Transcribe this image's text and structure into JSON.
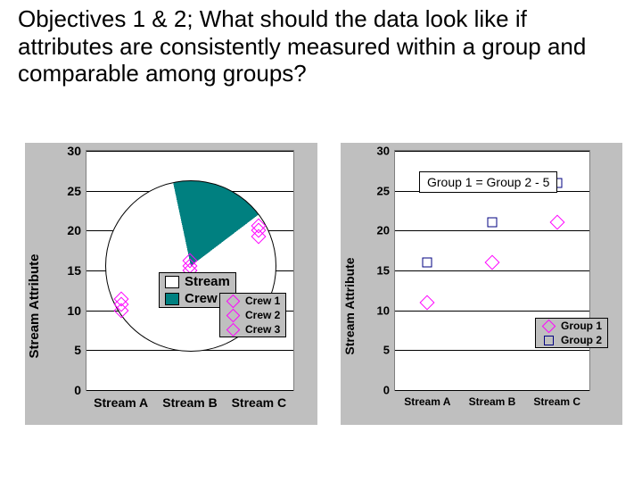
{
  "title": "Objectives 1 & 2; What should the data look like if attributes are consistently measured within a group and comparable among groups?",
  "left": {
    "ylabel": "Stream Attribute",
    "ymin": 0,
    "ymax": 30,
    "ystep": 5,
    "xcats": [
      "Stream A",
      "Stream B",
      "Stream C"
    ],
    "pie_legend": {
      "items": [
        {
          "label": "Stream",
          "fill": "#ffffff"
        },
        {
          "label": "Crew",
          "fill": "#008080"
        }
      ]
    },
    "pie": {
      "stream_frac": 0.82,
      "crew_frac": 0.18
    },
    "crew_legend": {
      "items": [
        {
          "label": "Crew 1"
        },
        {
          "label": "Crew 2"
        },
        {
          "label": "Crew 3"
        }
      ]
    },
    "series": [
      {
        "name": "Crew 1",
        "xi": 0,
        "y": 10
      },
      {
        "name": "Crew 2",
        "xi": 0,
        "y": 10.7
      },
      {
        "name": "Crew 3",
        "xi": 0,
        "y": 11.4
      },
      {
        "name": "Crew 1",
        "xi": 1,
        "y": 15
      },
      {
        "name": "Crew 2",
        "xi": 1,
        "y": 15.6
      },
      {
        "name": "Crew 3",
        "xi": 1,
        "y": 16.2
      },
      {
        "name": "Crew 1",
        "xi": 2,
        "y": 19.3
      },
      {
        "name": "Crew 2",
        "xi": 2,
        "y": 20
      },
      {
        "name": "Crew 3",
        "xi": 2,
        "y": 20.6
      }
    ]
  },
  "right": {
    "ylabel": "Stream Attribute",
    "ymin": 0,
    "ymax": 30,
    "ystep": 5,
    "xcats": [
      "Stream A",
      "Stream B",
      "Stream C"
    ],
    "annot": "Group 1 = Group 2 - 5",
    "legend": {
      "items": [
        {
          "label": "Group 1",
          "shape": "diamond"
        },
        {
          "label": "Group 2",
          "shape": "square"
        }
      ]
    },
    "series": [
      {
        "name": "Group 1",
        "shape": "diamond",
        "points": [
          {
            "xi": 0,
            "y": 11
          },
          {
            "xi": 1,
            "y": 16
          },
          {
            "xi": 2,
            "y": 21
          }
        ]
      },
      {
        "name": "Group 2",
        "shape": "square",
        "points": [
          {
            "xi": 0,
            "y": 16
          },
          {
            "xi": 1,
            "y": 21
          },
          {
            "xi": 2,
            "y": 26
          }
        ]
      }
    ]
  },
  "chart_data": [
    {
      "type": "scatter",
      "title": "",
      "xlabel": "",
      "ylabel": "Stream Attribute",
      "ylim": [
        0,
        30
      ],
      "categories": [
        "Stream A",
        "Stream B",
        "Stream C"
      ],
      "series": [
        {
          "name": "Crew 1",
          "values": [
            10,
            15,
            19.3
          ]
        },
        {
          "name": "Crew 2",
          "values": [
            10.7,
            15.6,
            20
          ]
        },
        {
          "name": "Crew 3",
          "values": [
            11.4,
            16.2,
            20.6
          ]
        }
      ],
      "inset_pie": {
        "type": "pie",
        "slices": [
          {
            "label": "Stream",
            "value": 0.82
          },
          {
            "label": "Crew",
            "value": 0.18
          }
        ]
      }
    },
    {
      "type": "scatter",
      "title": "",
      "xlabel": "",
      "ylabel": "Stream Attribute",
      "ylim": [
        0,
        30
      ],
      "categories": [
        "Stream A",
        "Stream B",
        "Stream C"
      ],
      "annotation": "Group 1 = Group 2 - 5",
      "series": [
        {
          "name": "Group 1",
          "values": [
            11,
            16,
            21
          ]
        },
        {
          "name": "Group 2",
          "values": [
            16,
            21,
            26
          ]
        }
      ]
    }
  ]
}
